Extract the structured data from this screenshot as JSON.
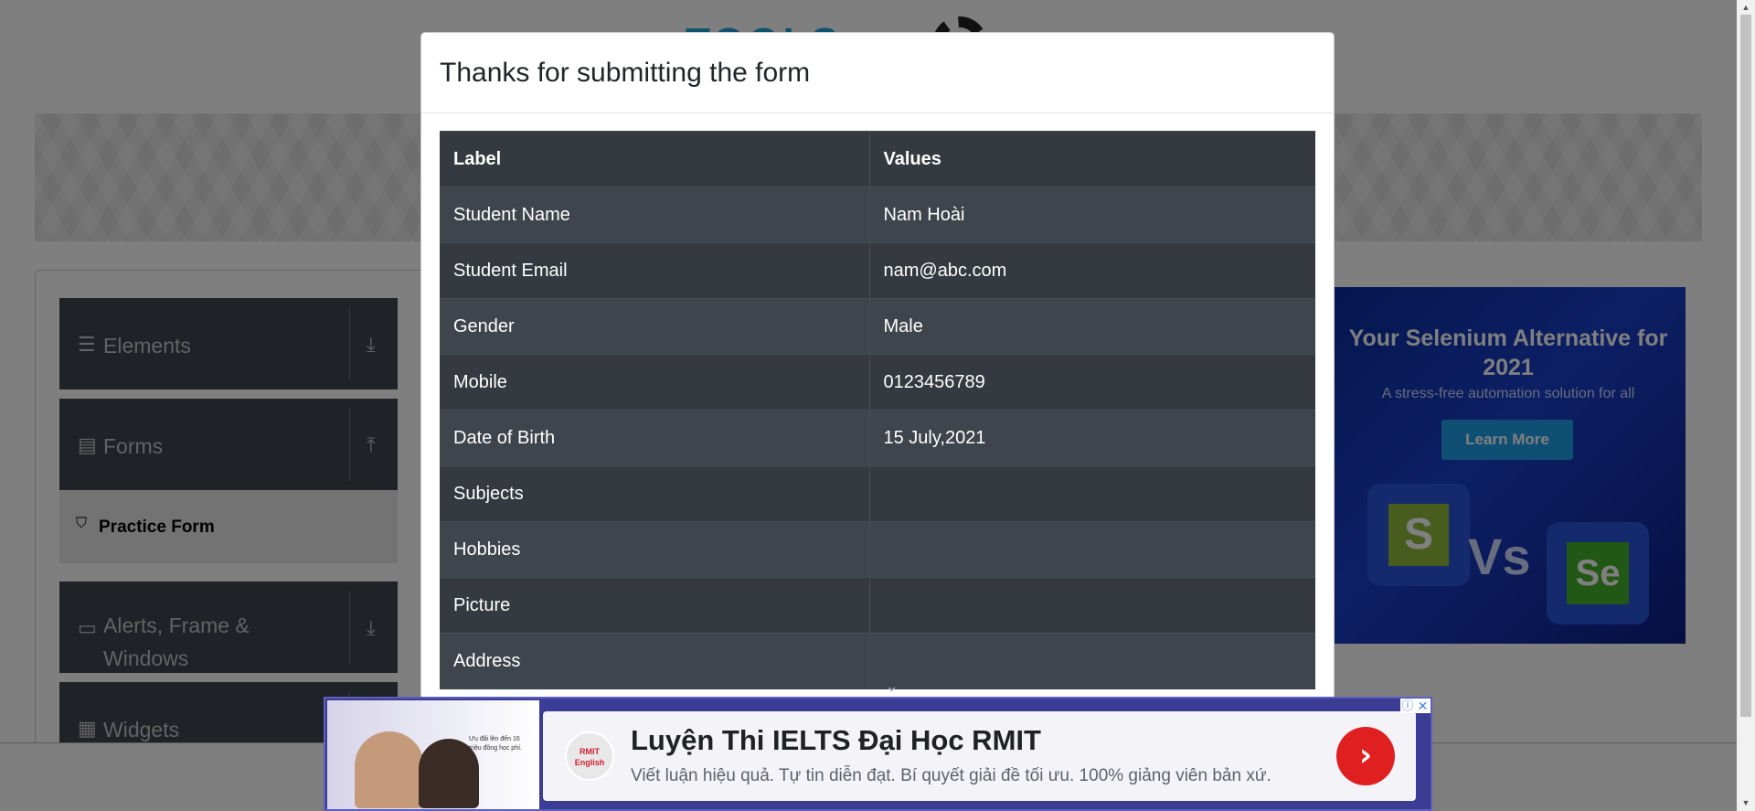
{
  "background": {
    "logo_text": "TOOLS",
    "sidebar": {
      "groups": [
        {
          "label": "Elements",
          "icon": "hamburger-icon",
          "arrow": "download-arrow-icon"
        },
        {
          "label": "Forms",
          "icon": "document-icon",
          "arrow": "upload-arrow-icon"
        },
        {
          "label": "Alerts, Frame & Windows",
          "icon": "window-icon",
          "arrow": "download-arrow-icon"
        },
        {
          "label": "Widgets",
          "icon": "widgets-icon",
          "arrow": "download-arrow-icon"
        }
      ],
      "active_item": "Practice Form"
    },
    "right_ad": {
      "title": "Your Selenium Alternative for 2021",
      "subtitle": "A stress-free automation solution for all",
      "button": "Learn More",
      "vs": "Vs",
      "left_logo": "S",
      "right_logo": "Se"
    }
  },
  "modal": {
    "title": "Thanks for submitting the form",
    "table": {
      "headers": [
        "Label",
        "Values"
      ],
      "rows": [
        [
          "Student Name",
          "Nam Hoài"
        ],
        [
          "Student Email",
          "nam@abc.com"
        ],
        [
          "Gender",
          "Male"
        ],
        [
          "Mobile",
          "0123456789"
        ],
        [
          "Date of Birth",
          "15 July,2021"
        ],
        [
          "Subjects",
          ""
        ],
        [
          "Hobbies",
          ""
        ],
        [
          "Picture",
          ""
        ],
        [
          "Address",
          ""
        ]
      ]
    }
  },
  "bottom_ad": {
    "headline": "Luyện Thi IELTS Đại Học RMIT",
    "description": "Viết luận hiệu quả. Tự tin diễn đạt. Bí quyết giải đề tối ưu. 100% giảng viên bản xứ.",
    "logo_text": "RMIT English",
    "thumb_text": "Ưu đãi lên đến 16 triệu đồng học phí.",
    "info": "ⓘ",
    "close": "✕"
  },
  "colors": {
    "overlay": "#000000",
    "table_dark": "#343a40",
    "table_stripe": "#3f454c",
    "ad_accent": "#e02020",
    "right_ad_blue": "#1a3fc9"
  }
}
